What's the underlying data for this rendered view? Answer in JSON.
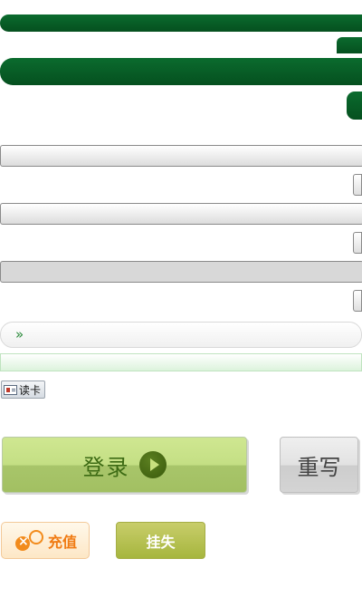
{
  "form": {
    "field1_value": "",
    "field2_value": "",
    "field3_value": "",
    "chevron_glyph": "»",
    "read_card_label": "读卡"
  },
  "actions": {
    "login_label": "登录",
    "reset_label": "重写",
    "recharge_label": "充值",
    "report_loss_label": "挂失"
  },
  "colors": {
    "header_green": "#05501f",
    "login_green": "#c4df84",
    "recharge_orange": "#f07a12",
    "loss_olive": "#a6b63e"
  }
}
